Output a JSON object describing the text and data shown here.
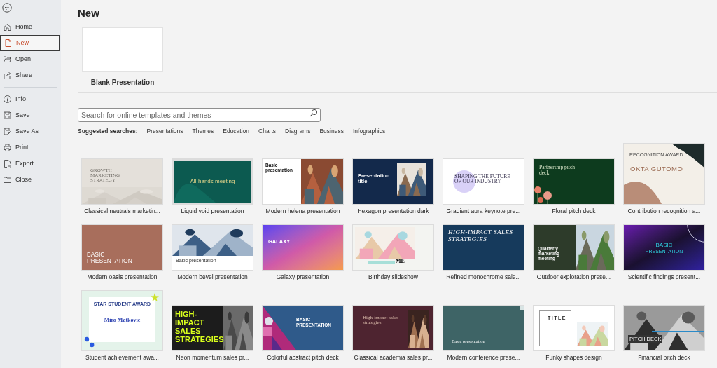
{
  "sidebar": {
    "groups": [
      {
        "items": [
          {
            "kind": "home",
            "label": "Home",
            "selected": false
          },
          {
            "kind": "new",
            "label": "New",
            "selected": true
          },
          {
            "kind": "open",
            "label": "Open",
            "selected": false
          },
          {
            "kind": "share",
            "label": "Share",
            "selected": false
          }
        ]
      },
      {
        "items": [
          {
            "kind": "info",
            "label": "Info",
            "selected": false
          },
          {
            "kind": "save",
            "label": "Save",
            "selected": false
          },
          {
            "kind": "saveas",
            "label": "Save As",
            "selected": false
          },
          {
            "kind": "print",
            "label": "Print",
            "selected": false
          },
          {
            "kind": "export",
            "label": "Export",
            "selected": false
          },
          {
            "kind": "close",
            "label": "Close",
            "selected": false
          }
        ]
      }
    ]
  },
  "page_title": "New",
  "blank": {
    "label": "Blank Presentation"
  },
  "search": {
    "placeholder": "Search for online templates and themes"
  },
  "suggested": {
    "label": "Suggested searches:",
    "links": [
      "Presentations",
      "Themes",
      "Education",
      "Charts",
      "Diagrams",
      "Business",
      "Infographics"
    ]
  },
  "templates": [
    {
      "kind": "classical",
      "label": "Classical neutrals marketin...",
      "slide_text": [
        "GROWTH MARKETING STRATEGY"
      ]
    },
    {
      "kind": "liquid",
      "label": "Liquid void presentation",
      "slide_text": [
        "All-hands meeting"
      ]
    },
    {
      "kind": "helena",
      "label": "Modern helena presentation",
      "slide_text": [
        "Basic presentation"
      ]
    },
    {
      "kind": "hexagon",
      "label": "Hexagon presentation dark",
      "slide_text": [
        "Presentation title"
      ]
    },
    {
      "kind": "aura",
      "label": "Gradient aura keynote pre...",
      "slide_text": [
        "SHAPING THE FUTURE OF OUR INDUSTRY"
      ]
    },
    {
      "kind": "floral",
      "label": "Floral pitch deck",
      "slide_text": [
        "Partnership pitch deck"
      ]
    },
    {
      "kind": "contribution",
      "label": "Contribution recognition a...",
      "slide_text": [
        "RECOGNITION AWARD",
        "OKTA GUTOMO"
      ]
    },
    {
      "kind": "oasis",
      "label": "Modern oasis presentation",
      "slide_text": [
        "BASIC PRESENTATION"
      ]
    },
    {
      "kind": "bevel",
      "label": "Modern bevel presentation",
      "slide_text": [
        "Basic presentation"
      ]
    },
    {
      "kind": "galaxy",
      "label": "Galaxy presentation",
      "slide_text": [
        "GALAXY"
      ]
    },
    {
      "kind": "birthday",
      "label": "Birthday slideshow",
      "slide_text": [
        "ME"
      ]
    },
    {
      "kind": "refined",
      "label": "Refined monochrome sale...",
      "slide_text": [
        "HIGH-IMPACT SALES STRATEGIES"
      ]
    },
    {
      "kind": "outdoor",
      "label": "Outdoor exploration prese...",
      "slide_text": [
        "Quarterly marketing meeting"
      ]
    },
    {
      "kind": "scientific",
      "label": "Scientific findings present...",
      "slide_text": [
        "BASIC",
        "PRESENTATION"
      ]
    },
    {
      "kind": "student",
      "label": "Student achievement awa...",
      "slide_text": [
        "STAR STUDENT AWARD",
        "Miro Matkovic"
      ]
    },
    {
      "kind": "neon",
      "label": "Neon momentum sales pr...",
      "slide_text": [
        "HIGH-IMPACT SALES STRATEGIES"
      ]
    },
    {
      "kind": "colorful",
      "label": "Colorful abstract pitch deck",
      "slide_text": [
        "BASIC PRESENTATION"
      ]
    },
    {
      "kind": "academia",
      "label": "Classical academia sales pr...",
      "slide_text": [
        "High-impact sales strategies"
      ]
    },
    {
      "kind": "conference",
      "label": "Modern conference prese...",
      "slide_text": [
        "Basic presentation"
      ]
    },
    {
      "kind": "funky",
      "label": "Funky shapes design",
      "slide_text": [
        "TITLE"
      ]
    },
    {
      "kind": "financial",
      "label": "Financial pitch deck",
      "slide_text": [
        "PITCH DECK"
      ]
    }
  ]
}
